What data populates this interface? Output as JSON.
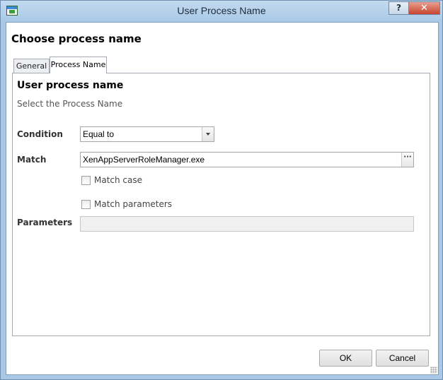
{
  "window": {
    "title": "User Process Name",
    "help_label": "?",
    "close_label": "✕"
  },
  "header": {
    "title": "Choose process name"
  },
  "tabs": [
    {
      "label": "General"
    },
    {
      "label": "Process Name",
      "selected": true
    }
  ],
  "panel": {
    "title": "User process name",
    "subtitle": "Select the Process Name"
  },
  "form": {
    "condition": {
      "label": "Condition",
      "value": "Equal to"
    },
    "match": {
      "label": "Match",
      "value": "XenAppServerRoleManager.exe",
      "browse_label": "···"
    },
    "match_case": {
      "label": "Match case",
      "checked": false
    },
    "match_parameters": {
      "label": "Match parameters",
      "checked": false
    },
    "parameters": {
      "label": "Parameters",
      "value": ""
    }
  },
  "footer": {
    "ok_label": "OK",
    "cancel_label": "Cancel"
  },
  "colors": {
    "titlebar": "#aac8e6",
    "close_button": "#c8452e",
    "panel_border": "#a4a9b3"
  }
}
